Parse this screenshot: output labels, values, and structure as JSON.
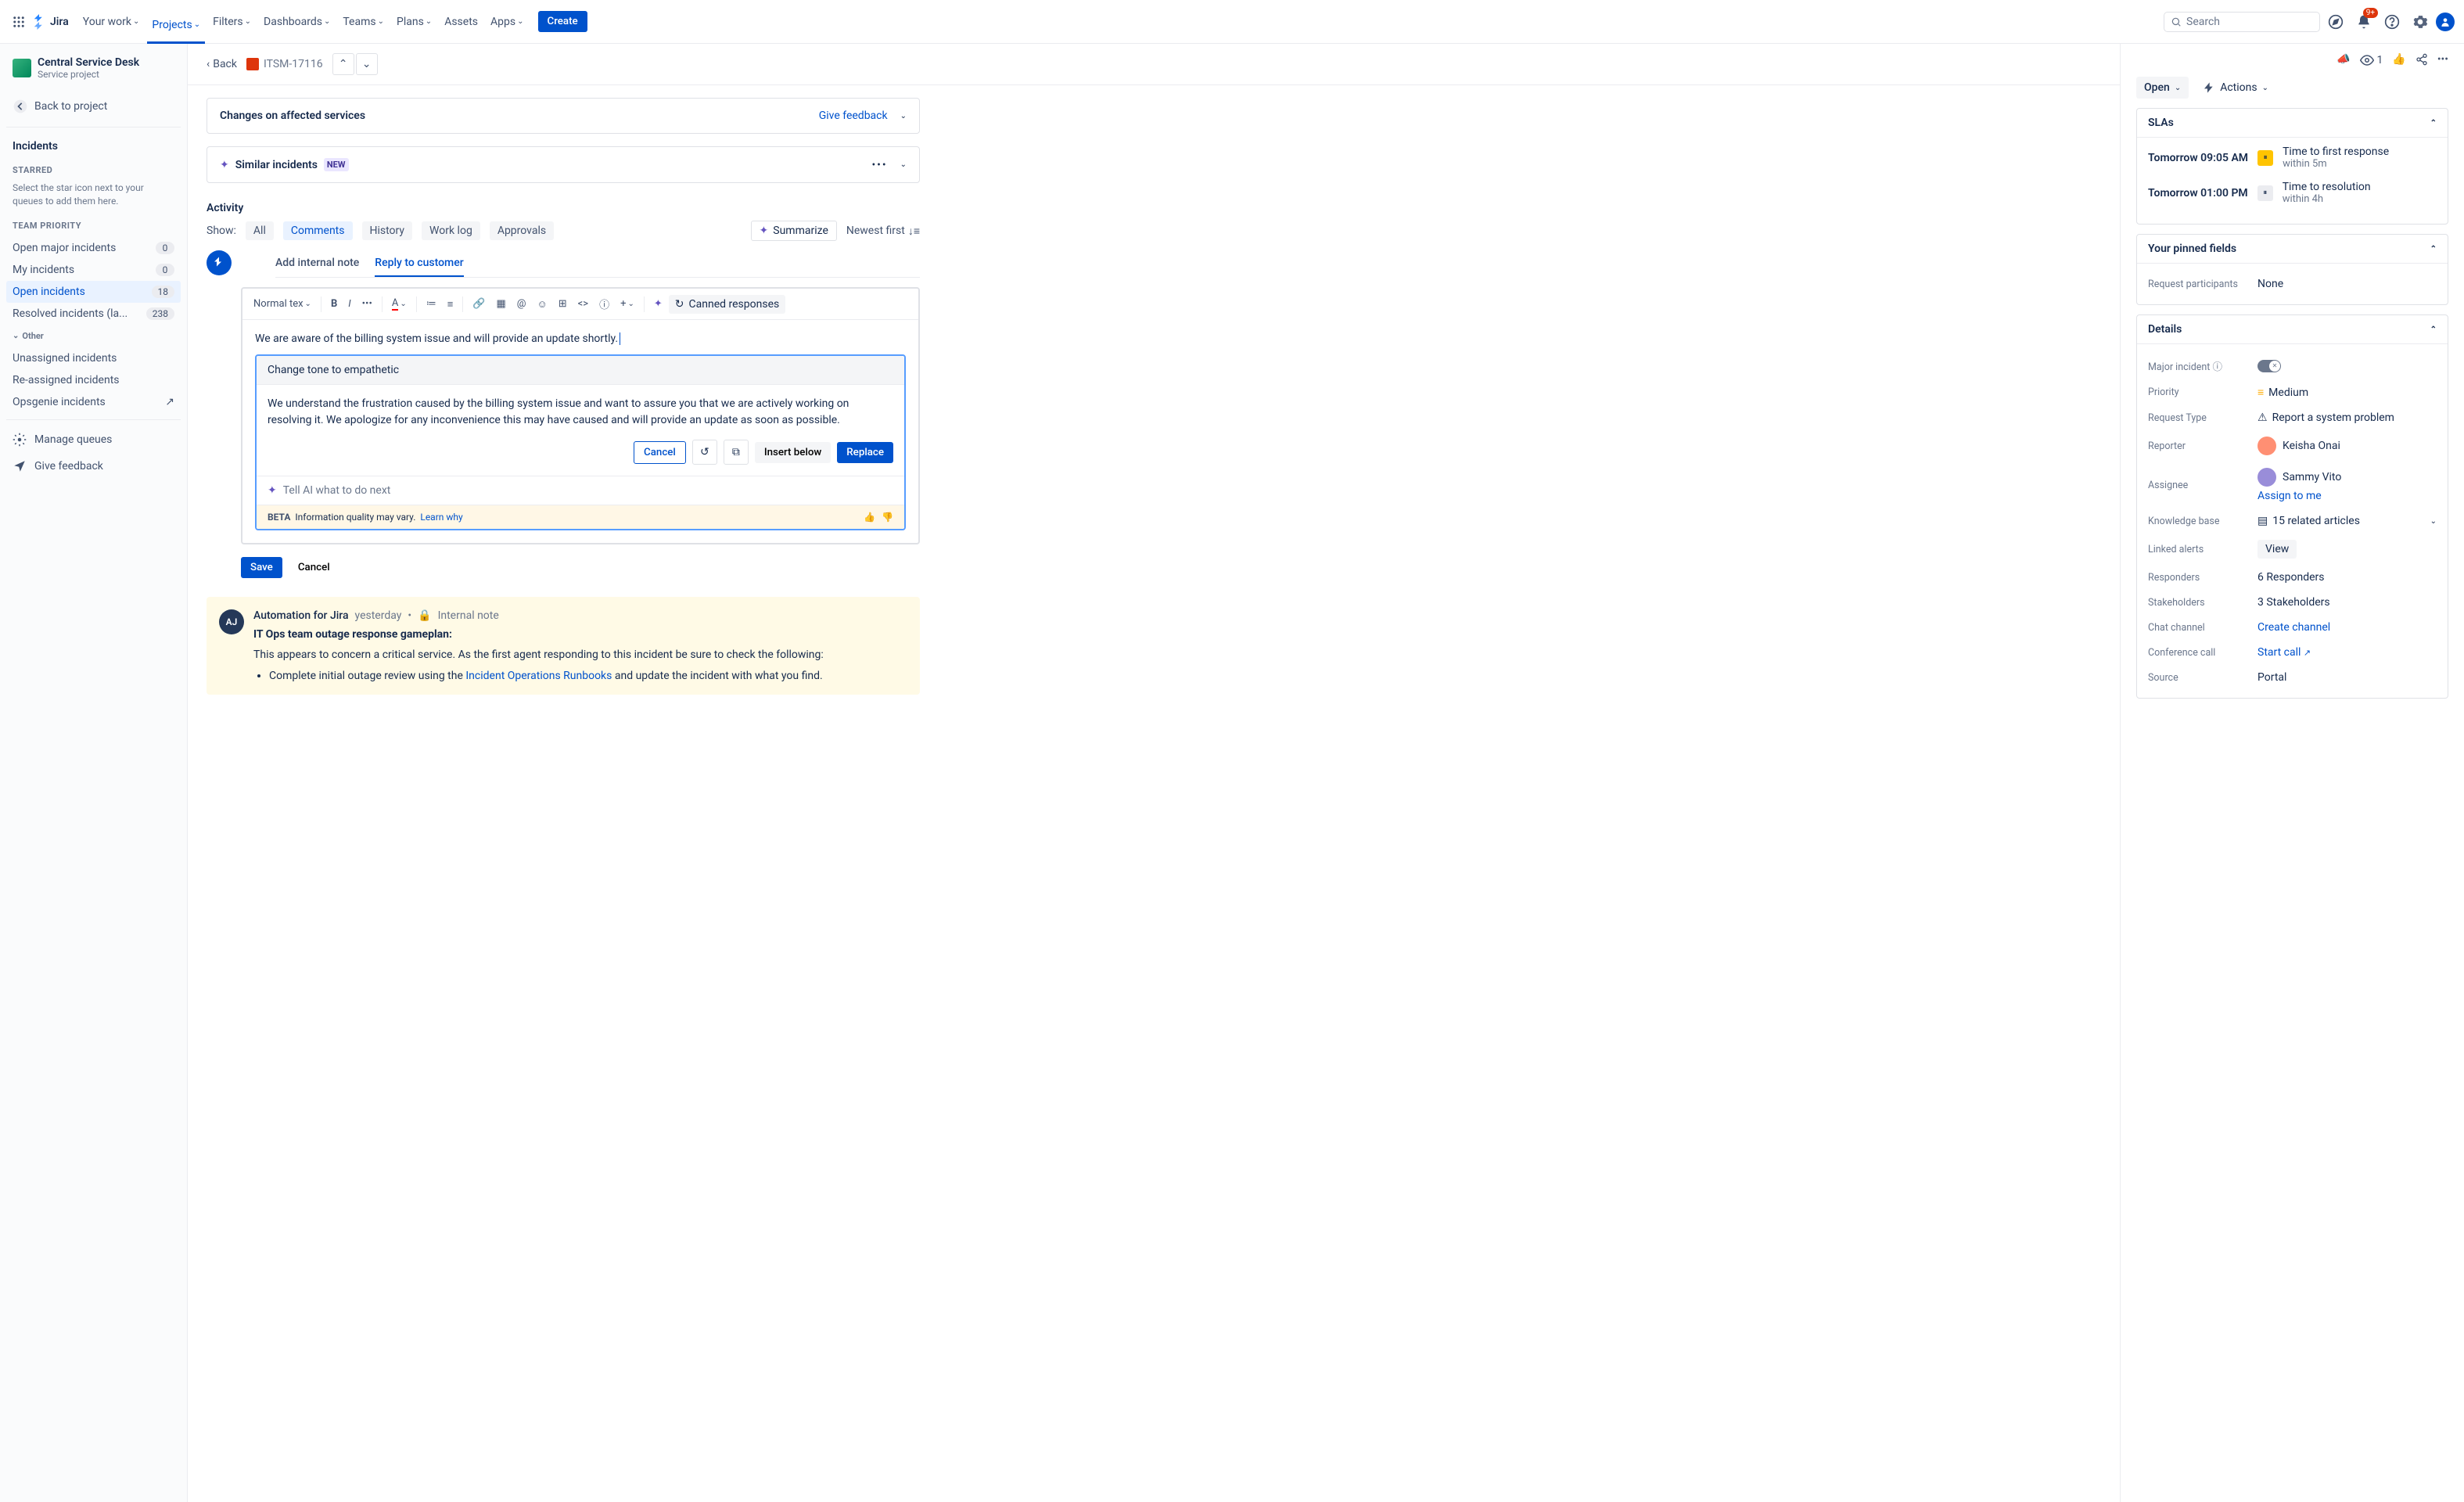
{
  "nav": {
    "logo": "Jira",
    "items": [
      "Your work",
      "Projects",
      "Filters",
      "Dashboards",
      "Teams",
      "Plans",
      "Assets",
      "Apps"
    ],
    "active_index": 1,
    "create": "Create",
    "search_placeholder": "Search",
    "notif_badge": "9+"
  },
  "sidebar": {
    "project_name": "Central Service Desk",
    "project_type": "Service project",
    "back": "Back to project",
    "incidents": "Incidents",
    "starred_label": "Starred",
    "starred_hint": "Select the star icon next to your queues to add them here.",
    "team_priority_label": "Team priority",
    "queues": [
      {
        "label": "Open major incidents",
        "count": "0"
      },
      {
        "label": "My incidents",
        "count": "0"
      },
      {
        "label": "Open incidents",
        "count": "18"
      },
      {
        "label": "Resolved incidents (la...",
        "count": "238"
      }
    ],
    "active_queue": 2,
    "other_label": "Other",
    "other_items": [
      "Unassigned incidents",
      "Re-assigned incidents",
      "Opsgenie incidents"
    ],
    "manage": "Manage queues",
    "feedback": "Give feedback"
  },
  "breadcrumb": {
    "back": "Back",
    "key": "ITSM-17116"
  },
  "panels": {
    "affected": "Changes on affected services",
    "give_feedback": "Give feedback",
    "similar": "Similar incidents",
    "new": "NEW"
  },
  "activity": {
    "title": "Activity",
    "show": "Show:",
    "tabs": [
      "All",
      "Comments",
      "History",
      "Work log",
      "Approvals"
    ],
    "active_tab": 1,
    "summarize": "Summarize",
    "sort": "Newest first",
    "add_note": "Add internal note",
    "reply": "Reply to customer"
  },
  "editor": {
    "text_style": "Normal tex",
    "canned": "Canned responses",
    "typed": "We are aware of the billing system issue and will provide an update shortly."
  },
  "ai": {
    "prompt": "Change tone to empathetic",
    "result": "We understand the frustration caused by the billing system issue and want to assure you that we are actively working on resolving it. We apologize for any inconvenience this may have caused and will provide an update as soon as possible.",
    "cancel": "Cancel",
    "insert_below": "Insert below",
    "replace": "Replace",
    "next_placeholder": "Tell AI what to do next",
    "beta": "BETA",
    "disclaimer": "Information quality may vary.",
    "learn": "Learn why"
  },
  "save_row": {
    "save": "Save",
    "cancel": "Cancel"
  },
  "auto": {
    "author": "Automation for Jira",
    "when": "yesterday",
    "internal": "Internal note",
    "heading": "IT Ops team outage response gameplan:",
    "para": "This appears to concern a critical service. As the first agent responding to this incident be sure to check the following:",
    "bullet_pre": "Complete initial outage review using the ",
    "bullet_link": "Incident Operations Runbooks",
    "bullet_post": " and update the incident with what you find."
  },
  "details": {
    "watch_count": "1",
    "status": "Open",
    "actions": "Actions",
    "slas_title": "SLAs",
    "slas": [
      {
        "time": "Tomorrow 09:05 AM",
        "status": "warn",
        "label": "Time to first response",
        "sub": "within 5m"
      },
      {
        "time": "Tomorrow 01:00 PM",
        "status": "norm",
        "label": "Time to resolution",
        "sub": "within 4h"
      }
    ],
    "pinned_title": "Your pinned fields",
    "pinned": {
      "label": "Request participants",
      "val": "None"
    },
    "details_title": "Details",
    "fields": {
      "major": {
        "label": "Major incident"
      },
      "priority": {
        "label": "Priority",
        "val": "Medium"
      },
      "reqtype": {
        "label": "Request Type",
        "val": "Report a system problem"
      },
      "reporter": {
        "label": "Reporter",
        "val": "Keisha Onai"
      },
      "assignee": {
        "label": "Assignee",
        "val": "Sammy Vito",
        "link": "Assign to me"
      },
      "kb": {
        "label": "Knowledge base",
        "val": "15 related articles"
      },
      "alerts": {
        "label": "Linked alerts",
        "val": "View"
      },
      "responders": {
        "label": "Responders",
        "val": "6 Responders"
      },
      "stakeholders": {
        "label": "Stakeholders",
        "val": "3 Stakeholders"
      },
      "chat": {
        "label": "Chat channel",
        "val": "Create channel"
      },
      "conf": {
        "label": "Conference call",
        "val": "Start call"
      },
      "source": {
        "label": "Source",
        "val": "Portal"
      }
    }
  }
}
